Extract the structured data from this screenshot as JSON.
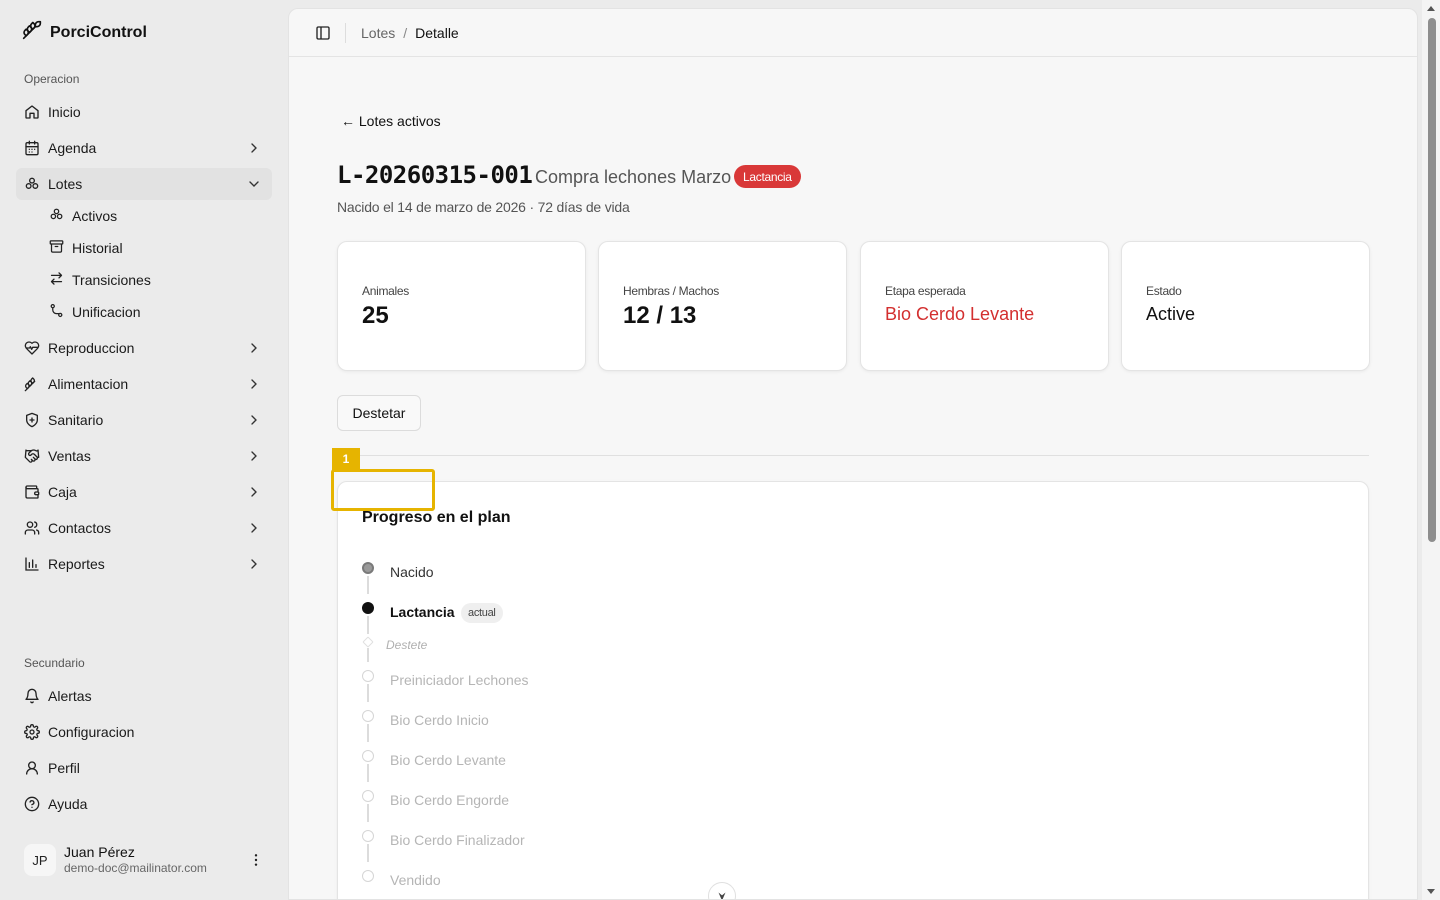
{
  "app": {
    "name": "PorciControl"
  },
  "sidebar": {
    "section_primary": "Operacion",
    "section_secondary": "Secundario",
    "items": [
      {
        "label": "Inicio",
        "icon": "home-icon"
      },
      {
        "label": "Agenda",
        "icon": "calendar-icon"
      },
      {
        "label": "Lotes",
        "icon": "lots-icon"
      },
      {
        "label": "Reproduccion",
        "icon": "heart-pulse-icon"
      },
      {
        "label": "Alimentacion",
        "icon": "wheat-icon"
      },
      {
        "label": "Sanitario",
        "icon": "shield-icon"
      },
      {
        "label": "Ventas",
        "icon": "handshake-icon"
      },
      {
        "label": "Caja",
        "icon": "wallet-icon"
      },
      {
        "label": "Contactos",
        "icon": "users-icon"
      },
      {
        "label": "Reportes",
        "icon": "bar-chart-icon"
      }
    ],
    "lotes_sub": [
      {
        "label": "Activos",
        "icon": "lots-icon"
      },
      {
        "label": "Historial",
        "icon": "archive-icon"
      },
      {
        "label": "Transiciones",
        "icon": "arrows-icon"
      },
      {
        "label": "Unificacion",
        "icon": "merge-icon"
      }
    ],
    "secondary_items": [
      {
        "label": "Alertas",
        "icon": "bell-icon"
      },
      {
        "label": "Configuracion",
        "icon": "gear-icon"
      },
      {
        "label": "Perfil",
        "icon": "user-icon"
      },
      {
        "label": "Ayuda",
        "icon": "help-icon"
      }
    ],
    "user": {
      "initials": "JP",
      "name": "Juan Pérez",
      "email": "demo-doc@mailinator.com"
    }
  },
  "breadcrumb": {
    "parent": "Lotes",
    "separator": "/",
    "current": "Detalle"
  },
  "back_link": "← Lotes activos",
  "lot": {
    "code": "L-20260315-001",
    "name": "Compra lechones Marzo",
    "stage_badge": "Lactancia",
    "subtitle": "Nacido el 14 de marzo de 2026 · 72 días de vida"
  },
  "stats": [
    {
      "label": "Animales",
      "value": "25"
    },
    {
      "label": "Hembras / Machos",
      "value": "12 / 13"
    },
    {
      "label": "Etapa esperada",
      "value": "Bio Cerdo Levante"
    },
    {
      "label": "Estado",
      "value": "Active"
    }
  ],
  "actions": {
    "wean_label": "Destetar"
  },
  "plan": {
    "title": "Progreso en el plan",
    "current_tag": "actual",
    "steps": [
      {
        "label": "Nacido",
        "state": "done"
      },
      {
        "label": "Lactancia",
        "state": "current"
      },
      {
        "label": "Destete",
        "state": "event"
      },
      {
        "label": "Preiniciador Lechones",
        "state": "future"
      },
      {
        "label": "Bio Cerdo Inicio",
        "state": "future"
      },
      {
        "label": "Bio Cerdo Levante",
        "state": "future"
      },
      {
        "label": "Bio Cerdo Engorde",
        "state": "future"
      },
      {
        "label": "Bio Cerdo Finalizador",
        "state": "future"
      },
      {
        "label": "Vendido",
        "state": "future"
      }
    ]
  },
  "marker": {
    "label": "1"
  },
  "colors": {
    "badge_red": "#d93838",
    "expected_stage": "#d32f2f",
    "marker": "#e6b400"
  }
}
